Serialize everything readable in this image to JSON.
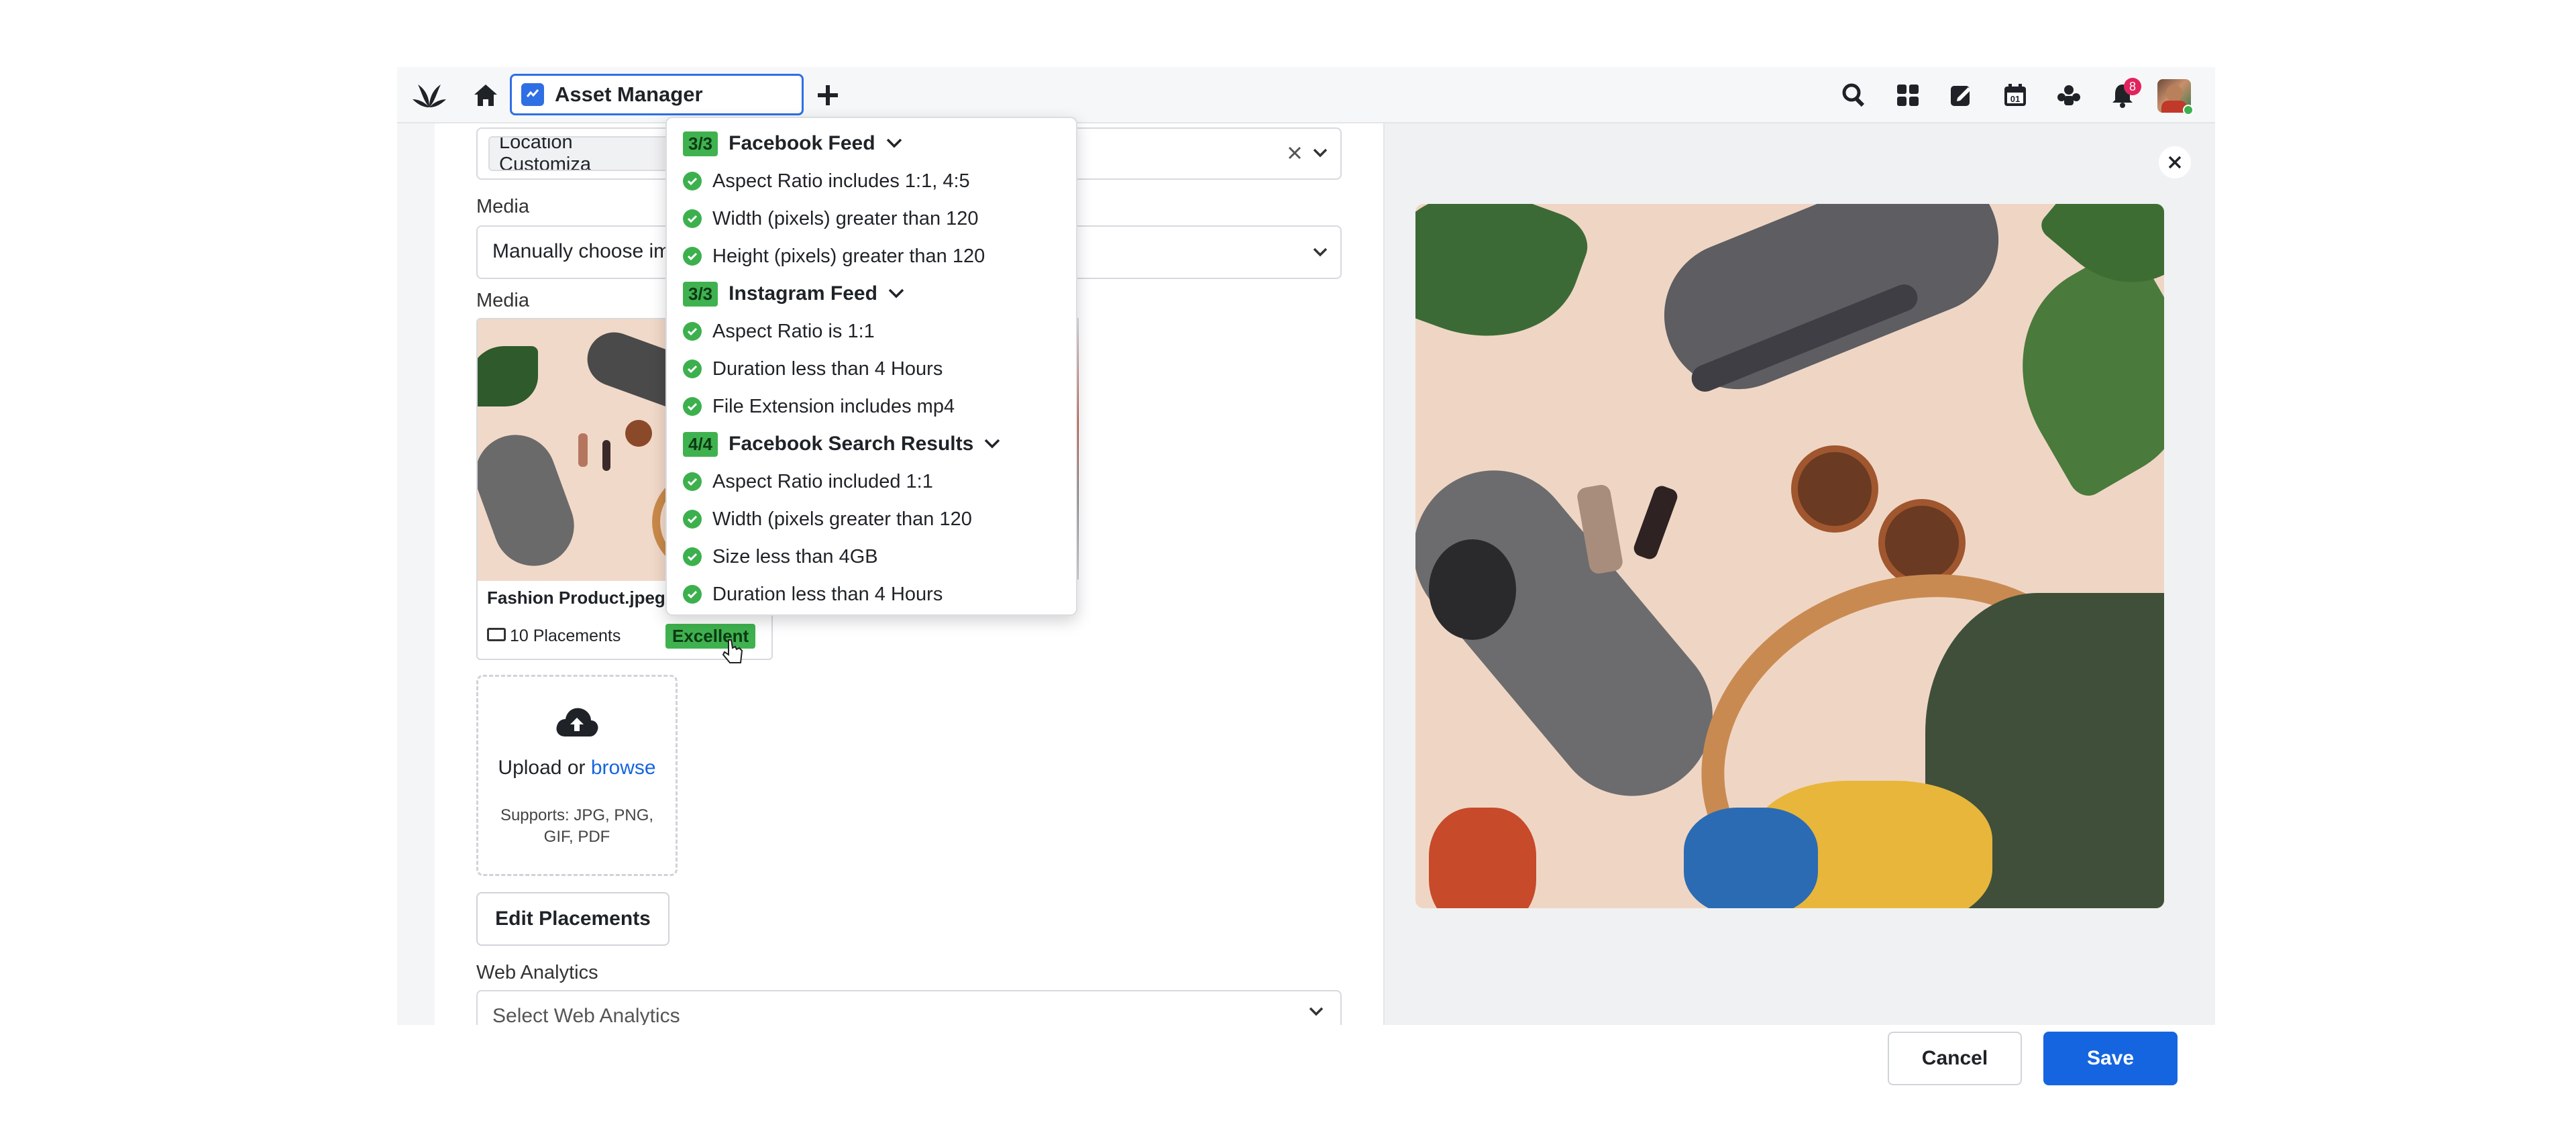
{
  "topbar": {
    "tab_title": "Asset Manager",
    "notification_count": "8",
    "icons": [
      "logo-icon",
      "home-icon",
      "add-tab-icon",
      "search-icon",
      "apps-grid-icon",
      "compose-icon",
      "calendar-icon",
      "team-icon",
      "bell-icon",
      "avatar"
    ]
  },
  "form": {
    "location_chip": "Location Customiza",
    "media_label_1": "Media",
    "media_select_value": "Manually choose im",
    "media_label_2": "Media",
    "asset_filename": "Fashion Product.jpeg",
    "placements_count": "10 Placements",
    "quality_badge": "Excellent",
    "upload_prefix": "Upload or",
    "upload_link": "browse",
    "upload_supports_1": "Supports: JPG, PNG,",
    "upload_supports_2": "GIF, PDF",
    "edit_placements_label": "Edit Placements",
    "web_analytics_label": "Web Analytics",
    "web_analytics_placeholder": "Select Web Analytics"
  },
  "popover": {
    "groups": [
      {
        "badge": "3/3",
        "title": "Facebook Feed",
        "rules": [
          "Aspect Ratio includes 1:1, 4:5",
          "Width (pixels) greater than 120",
          "Height (pixels) greater than 120"
        ]
      },
      {
        "badge": "3/3",
        "title": "Instagram Feed",
        "rules": [
          "Aspect Ratio is 1:1",
          "Duration less than 4 Hours",
          "File Extension includes mp4"
        ]
      },
      {
        "badge": "4/4",
        "title": "Facebook Search Results",
        "rules": [
          "Aspect Ratio included 1:1",
          "Width (pixels greater than 120",
          "Size less than 4GB",
          "Duration less than 4 Hours"
        ]
      }
    ]
  },
  "footer": {
    "cancel_label": "Cancel",
    "save_label": "Save"
  },
  "colors": {
    "accent": "#1565e0",
    "success": "#3fb24f",
    "badge_red": "#e0245e"
  }
}
